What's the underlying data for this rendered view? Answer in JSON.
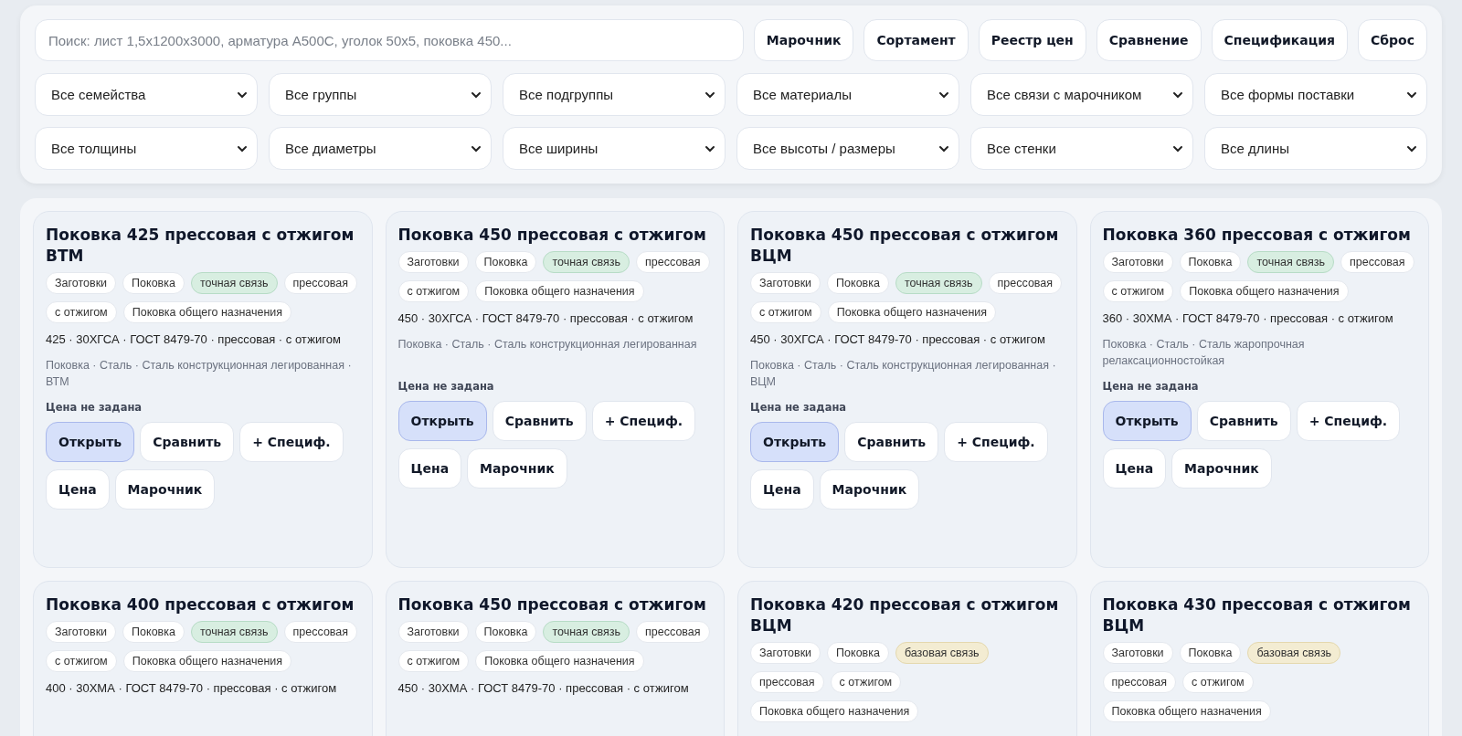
{
  "search": {
    "placeholder": "Поиск: лист 1,5x1200x3000, арматура А500С, уголок 50x5, поковка 450..."
  },
  "toolbar_buttons": [
    "Марочник",
    "Сортамент",
    "Реестр цен",
    "Сравнение",
    "Спецификация",
    "Сброс"
  ],
  "filters": [
    "Все семейства",
    "Все группы",
    "Все подгруппы",
    "Все материалы",
    "Все связи с марочником",
    "Все формы поставки",
    "Все толщины",
    "Все диаметры",
    "Все ширины",
    "Все высоты / размеры",
    "Все стенки",
    "Все длины"
  ],
  "cards": [
    {
      "title": "Поковка 425 прессовая с отжигом ВТМ",
      "tags": [
        {
          "label": "Заготовки",
          "kind": "plain"
        },
        {
          "label": "Поковка",
          "kind": "plain"
        },
        {
          "label": "точная связь",
          "kind": "exact"
        },
        {
          "label": "прессовая",
          "kind": "plain"
        },
        {
          "label": "с отжигом",
          "kind": "plain"
        },
        {
          "label": "Поковка общего назначения",
          "kind": "plain"
        }
      ],
      "spec": "425 · 30ХГСА · ГОСТ 8479-70 · прессовая · с отжигом",
      "category": "Поковка · Сталь · Сталь конструкционная легированная · ВТМ",
      "price": "Цена не задана",
      "buttons": [
        {
          "label": "Открыть",
          "kind": "primary"
        },
        {
          "label": "Сравнить",
          "kind": "default"
        },
        {
          "label": "+ Специф.",
          "kind": "default"
        },
        {
          "label": "Цена",
          "kind": "default"
        },
        {
          "label": "Марочник",
          "kind": "default"
        }
      ]
    },
    {
      "title": "Поковка 450 прессовая с отжигом",
      "tags": [
        {
          "label": "Заготовки",
          "kind": "plain"
        },
        {
          "label": "Поковка",
          "kind": "plain"
        },
        {
          "label": "точная связь",
          "kind": "exact"
        },
        {
          "label": "прессовая",
          "kind": "plain"
        },
        {
          "label": "с отжигом",
          "kind": "plain"
        },
        {
          "label": "Поковка общего назначения",
          "kind": "plain"
        }
      ],
      "spec": "450 · 30ХГСА · ГОСТ 8479-70 · прессовая · с отжигом",
      "category": "Поковка · Сталь · Сталь конструкционная легированная",
      "price": "Цена не задана",
      "buttons": [
        {
          "label": "Открыть",
          "kind": "primary"
        },
        {
          "label": "Сравнить",
          "kind": "default"
        },
        {
          "label": "+ Специф.",
          "kind": "default"
        },
        {
          "label": "Цена",
          "kind": "default"
        },
        {
          "label": "Марочник",
          "kind": "default"
        }
      ]
    },
    {
      "title": "Поковка 450 прессовая с отжигом ВЦМ",
      "tags": [
        {
          "label": "Заготовки",
          "kind": "plain"
        },
        {
          "label": "Поковка",
          "kind": "plain"
        },
        {
          "label": "точная связь",
          "kind": "exact"
        },
        {
          "label": "прессовая",
          "kind": "plain"
        },
        {
          "label": "с отжигом",
          "kind": "plain"
        },
        {
          "label": "Поковка общего назначения",
          "kind": "plain"
        }
      ],
      "spec": "450 · 30ХГСА · ГОСТ 8479-70 · прессовая · с отжигом",
      "category": "Поковка · Сталь · Сталь конструкционная легированная · ВЦМ",
      "price": "Цена не задана",
      "buttons": [
        {
          "label": "Открыть",
          "kind": "primary"
        },
        {
          "label": "Сравнить",
          "kind": "default"
        },
        {
          "label": "+ Специф.",
          "kind": "default"
        },
        {
          "label": "Цена",
          "kind": "default"
        },
        {
          "label": "Марочник",
          "kind": "default"
        }
      ]
    },
    {
      "title": "Поковка 360 прессовая с отжигом",
      "tags": [
        {
          "label": "Заготовки",
          "kind": "plain"
        },
        {
          "label": "Поковка",
          "kind": "plain"
        },
        {
          "label": "точная связь",
          "kind": "exact"
        },
        {
          "label": "прессовая",
          "kind": "plain"
        },
        {
          "label": "с отжигом",
          "kind": "plain"
        },
        {
          "label": "Поковка общего назначения",
          "kind": "plain"
        }
      ],
      "spec": "360 · 30ХМА · ГОСТ 8479-70 · прессовая · с отжигом",
      "category": "Поковка · Сталь · Сталь жаропрочная релаксационностойкая",
      "price": "Цена не задана",
      "buttons": [
        {
          "label": "Открыть",
          "kind": "primary"
        },
        {
          "label": "Сравнить",
          "kind": "default"
        },
        {
          "label": "+ Специф.",
          "kind": "default"
        },
        {
          "label": "Цена",
          "kind": "default"
        },
        {
          "label": "Марочник",
          "kind": "default"
        }
      ]
    },
    {
      "title": "Поковка 400 прессовая с отжигом",
      "tags": [
        {
          "label": "Заготовки",
          "kind": "plain"
        },
        {
          "label": "Поковка",
          "kind": "plain"
        },
        {
          "label": "точная связь",
          "kind": "exact"
        },
        {
          "label": "прессовая",
          "kind": "plain"
        },
        {
          "label": "с отжигом",
          "kind": "plain"
        },
        {
          "label": "Поковка общего назначения",
          "kind": "plain"
        }
      ],
      "spec": "400 · 30ХМА · ГОСТ 8479-70 · прессовая · с отжигом"
    },
    {
      "title": "Поковка 450 прессовая с отжигом",
      "tags": [
        {
          "label": "Заготовки",
          "kind": "plain"
        },
        {
          "label": "Поковка",
          "kind": "plain"
        },
        {
          "label": "точная связь",
          "kind": "exact"
        },
        {
          "label": "прессовая",
          "kind": "plain"
        },
        {
          "label": "с отжигом",
          "kind": "plain"
        },
        {
          "label": "Поковка общего назначения",
          "kind": "plain"
        }
      ],
      "spec": "450 · 30ХМА · ГОСТ 8479-70 · прессовая · с отжигом"
    },
    {
      "title": "Поковка 420 прессовая с отжигом ВЦМ",
      "tags": [
        {
          "label": "Заготовки",
          "kind": "plain"
        },
        {
          "label": "Поковка",
          "kind": "plain"
        },
        {
          "label": "базовая связь",
          "kind": "base"
        },
        {
          "label": "прессовая",
          "kind": "plain"
        },
        {
          "label": "с отжигом",
          "kind": "plain"
        },
        {
          "label": "Поковка общего назначения",
          "kind": "plain"
        }
      ]
    },
    {
      "title": "Поковка 430 прессовая с отжигом ВЦМ",
      "tags": [
        {
          "label": "Заготовки",
          "kind": "plain"
        },
        {
          "label": "Поковка",
          "kind": "plain"
        },
        {
          "label": "базовая связь",
          "kind": "base"
        },
        {
          "label": "прессовая",
          "kind": "plain"
        },
        {
          "label": "с отжигом",
          "kind": "plain"
        },
        {
          "label": "Поковка общего назначения",
          "kind": "plain"
        }
      ]
    }
  ]
}
